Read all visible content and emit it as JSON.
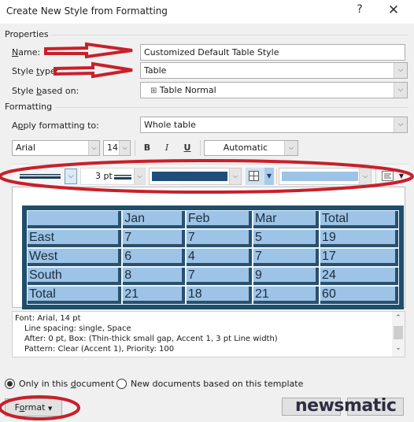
{
  "window": {
    "title": "Create New Style from Formatting",
    "help_label": "?",
    "close_label": "✕"
  },
  "properties": {
    "section_label": "Properties",
    "name_label": "Name:",
    "name_label_mnemonic": "N",
    "name_value": "Customized Default Table Style",
    "style_type_label": "Style type:",
    "style_type_value": "Table",
    "style_based_on_label": "Style based on:",
    "style_based_on_value": "Table Normal",
    "style_based_on_icon": "table-grid-icon"
  },
  "formatting": {
    "section_label": "Formatting",
    "apply_to_label": "Apply formatting to:",
    "apply_to_value": "Whole table",
    "font_name": "Arial",
    "font_size": "14",
    "bold_label": "B",
    "italic_label": "I",
    "underline_label": "U",
    "font_color": "Automatic",
    "border_style": "thin-thick small gap",
    "border_width": "3 pt",
    "border_color": "#1f4e79",
    "borders_icon": "all-borders-icon",
    "shading_color": "#9dc3e6",
    "alignment_icon": "cell-alignment-icon"
  },
  "preview": {
    "rows": [
      [
        "",
        "Jan",
        "Feb",
        "Mar",
        "Total"
      ],
      [
        "East",
        "7",
        "7",
        "5",
        "19"
      ],
      [
        "West",
        "6",
        "4",
        "7",
        "17"
      ],
      [
        "South",
        "8",
        "7",
        "9",
        "24"
      ],
      [
        "Total",
        "21",
        "18",
        "21",
        "60"
      ]
    ]
  },
  "description": {
    "lines": [
      "Font: Arial, 14 pt",
      "Line spacing:  single, Space",
      "After:  0 pt, Box: (Thin-thick small gap, Accent 1,  3 pt Line width)",
      "Pattern: Clear (Accent 1), Priority: 100"
    ]
  },
  "scope": {
    "only_this_document": "Only in this document",
    "new_documents": "New documents based on this template",
    "selected": "only_this_document"
  },
  "buttons": {
    "format": "Format",
    "ok": "OK",
    "cancel": "Cancel"
  },
  "watermark": "newsmatic",
  "colors": {
    "annotation_red": "#c8202a",
    "table_border": "#1f4e6b",
    "table_fill": "#9dc3e6"
  }
}
